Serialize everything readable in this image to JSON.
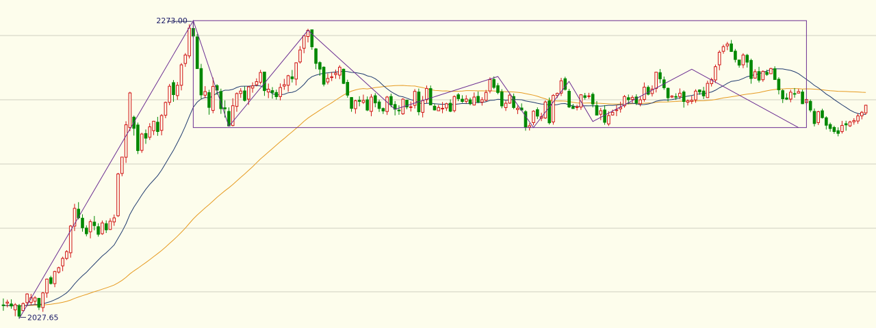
{
  "chart_data": {
    "type": "candlestick",
    "ylim": [
      2020,
      2290
    ],
    "grid": true,
    "colors": {
      "up": "#d01010",
      "down": "#008800",
      "ma_short": "#1f3a6e",
      "ma_long": "#e69a20",
      "annotation": "#6a2c91",
      "grid": "#cfcfc0",
      "background": "#fdfdec"
    },
    "annotations": {
      "high_label": "2273.00",
      "low_label": "2027.65",
      "high_value": 2273.0,
      "low_value": 2027.65,
      "high_index": 48,
      "low_index": 4,
      "range_box": {
        "from_index": 48,
        "to_index": 203,
        "top": 2273.0,
        "bottom": 2185.0
      },
      "wave_points": [
        [
          4,
          2027.65
        ],
        [
          48,
          2273.0
        ],
        [
          57,
          2186.0
        ],
        [
          77,
          2265.0
        ],
        [
          99,
          2200.0
        ],
        [
          125,
          2227.0
        ],
        [
          134,
          2185.0
        ],
        [
          143,
          2223.0
        ],
        [
          149,
          2190.0
        ],
        [
          174,
          2233.0
        ],
        [
          201,
          2185.0
        ]
      ]
    },
    "candles": [
      [
        2039.0,
        2038.4,
        2044.3,
        2034.2
      ],
      [
        2040.4,
        2041.3,
        2043.3,
        2037.0
      ],
      [
        2039.8,
        2038.1,
        2043.6,
        2035.9
      ],
      [
        2034.9,
        2039.1,
        2040.5,
        2029.7
      ],
      [
        2038.5,
        2029.7,
        2039.8,
        2027.6
      ],
      [
        2034.3,
        2040.1,
        2041.1,
        2033.9
      ],
      [
        2040.9,
        2048.0,
        2048.6,
        2037.9
      ],
      [
        2041.0,
        2044.9,
        2048.1,
        2038.8
      ],
      [
        2042.0,
        2044.8,
        2046.3,
        2039.1
      ],
      [
        2044.4,
        2037.1,
        2044.8,
        2034.8
      ],
      [
        2036.8,
        2048.9,
        2049.6,
        2033.3
      ],
      [
        2048.8,
        2060.3,
        2060.6,
        2044.9
      ],
      [
        2061.4,
        2056.6,
        2063.0,
        2055.8
      ],
      [
        2056.5,
        2066.5,
        2067.1,
        2053.6
      ],
      [
        2066.0,
        2069.6,
        2070.5,
        2064.8
      ],
      [
        2071.1,
        2077.3,
        2078.7,
        2066.8
      ],
      [
        2077.3,
        2082.9,
        2084.1,
        2076.0
      ],
      [
        2081.9,
        2103.9,
        2104.8,
        2077.9
      ],
      [
        2103.9,
        2118.5,
        2122.2,
        2099.8
      ],
      [
        2117.8,
        2110.7,
        2123.6,
        2109.4
      ],
      [
        2110.4,
        2102.5,
        2113.6,
        2099.3
      ],
      [
        2102.3,
        2097.6,
        2104.5,
        2095.5
      ],
      [
        2099.2,
        2107.5,
        2109.3,
        2093.8
      ],
      [
        2107.2,
        2104.3,
        2112.2,
        2100.4
      ],
      [
        2103.4,
        2097.1,
        2106.2,
        2095.2
      ],
      [
        2097.6,
        2106.5,
        2108.5,
        2096.7
      ],
      [
        2105.9,
        2100.8,
        2108.6,
        2098.2
      ],
      [
        2101.1,
        2107.9,
        2110.3,
        2100.7
      ],
      [
        2107.3,
        2110.6,
        2113.4,
        2104.1
      ],
      [
        2112.4,
        2146.8,
        2147.7,
        2111.4
      ],
      [
        2147.2,
        2160.7,
        2160.7,
        2144.9
      ],
      [
        2160.6,
        2187.3,
        2190.2,
        2155.9
      ],
      [
        2185.0,
        2213.5,
        2214.4,
        2182.0
      ],
      [
        2193.6,
        2184.4,
        2194.8,
        2178.4
      ],
      [
        2187.1,
        2166.0,
        2189.1,
        2163.2
      ],
      [
        2166.2,
        2179.7,
        2180.7,
        2164.2
      ],
      [
        2180.1,
        2176.3,
        2183.4,
        2171.6
      ],
      [
        2177.0,
        2185.6,
        2188.6,
        2174.8
      ],
      [
        2182.4,
        2190.2,
        2190.5,
        2178.8
      ],
      [
        2189.4,
        2181.7,
        2193.8,
        2178.2
      ],
      [
        2182.7,
        2194.9,
        2196.1,
        2178.6
      ],
      [
        2195.1,
        2205.7,
        2206.4,
        2192.7
      ],
      [
        2205.7,
        2219.0,
        2220.9,
        2203.4
      ],
      [
        2222.0,
        2212.1,
        2224.1,
        2206.2
      ],
      [
        2211.3,
        2219.8,
        2222.5,
        2207.8
      ],
      [
        2219.8,
        2236.6,
        2238.1,
        2215.6
      ],
      [
        2237.7,
        2244.7,
        2246.3,
        2235.0
      ],
      [
        2244.0,
        2266.9,
        2270.0,
        2241.9
      ],
      [
        2266.6,
        2260.3,
        2273.0,
        2258.6
      ],
      [
        2259.6,
        2233.5,
        2262.0,
        2233.4
      ],
      [
        2233.6,
        2211.9,
        2237.4,
        2208.3
      ],
      [
        2211.6,
        2214.6,
        2219.1,
        2209.1
      ],
      [
        2213.8,
        2201.6,
        2216.1,
        2195.6
      ],
      [
        2199.1,
        2218.9,
        2226.1,
        2196.8
      ],
      [
        2219.5,
        2215.8,
        2220.7,
        2211.9
      ],
      [
        2214.7,
        2200.6,
        2217.0,
        2196.3
      ],
      [
        2201.3,
        2200.4,
        2207.4,
        2193.2
      ],
      [
        2198.3,
        2186.3,
        2201.6,
        2186.0
      ],
      [
        2186.7,
        2203.0,
        2209.1,
        2186.0
      ],
      [
        2202.4,
        2213.0,
        2213.9,
        2198.0
      ],
      [
        2213.1,
        2215.1,
        2217.5,
        2209.4
      ],
      [
        2215.2,
        2207.3,
        2218.8,
        2206.5
      ],
      [
        2208.4,
        2218.5,
        2219.2,
        2203.7
      ],
      [
        2217.5,
        2219.3,
        2222.2,
        2213.7
      ],
      [
        2220.2,
        2222.8,
        2225.5,
        2218.9
      ],
      [
        2222.3,
        2230.3,
        2232.5,
        2220.5
      ],
      [
        2230.7,
        2215.4,
        2230.8,
        2211.1
      ],
      [
        2214.3,
        2216.6,
        2221.2,
        2209.2
      ],
      [
        2215.4,
        2213.9,
        2218.3,
        2208.8
      ],
      [
        2213.9,
        2210.4,
        2216.2,
        2208.0
      ],
      [
        2210.5,
        2218.0,
        2221.3,
        2207.4
      ],
      [
        2219.1,
        2220.3,
        2225.1,
        2216.1
      ],
      [
        2219.8,
        2227.7,
        2228.4,
        2214.5
      ],
      [
        2226.8,
        2225.2,
        2232.4,
        2222.1
      ],
      [
        2224.9,
        2238.3,
        2238.7,
        2219.7
      ],
      [
        2239.0,
        2248.9,
        2252.0,
        2237.7
      ],
      [
        2250.2,
        2260.5,
        2260.7,
        2246.2
      ],
      [
        2259.9,
        2265.0,
        2266.3,
        2255.1
      ],
      [
        2265.5,
        2251.5,
        2265.6,
        2249.0
      ],
      [
        2249.8,
        2237.8,
        2250.5,
        2233.1
      ],
      [
        2238.5,
        2233.1,
        2239.6,
        2227.6
      ],
      [
        2234.7,
        2220.7,
        2235.4,
        2218.9
      ],
      [
        2222.5,
        2225.4,
        2229.5,
        2220.5
      ],
      [
        2226.1,
        2226.8,
        2230.7,
        2223.3
      ],
      [
        2228.7,
        2229.8,
        2232.7,
        2225.2
      ],
      [
        2228.2,
        2234.7,
        2236.3,
        2224.9
      ],
      [
        2233.0,
        2221.3,
        2233.6,
        2220.8
      ],
      [
        2222.2,
        2211.6,
        2224.4,
        2209.6
      ],
      [
        2209.8,
        2200.8,
        2210.0,
        2198.0
      ],
      [
        2200.6,
        2207.1,
        2207.9,
        2196.4
      ],
      [
        2207.4,
        2206.5,
        2210.8,
        2202.5
      ],
      [
        2205.7,
        2207.3,
        2212.1,
        2204.4
      ],
      [
        2207.9,
        2199.4,
        2210.6,
        2198.5
      ],
      [
        2198.3,
        2210.1,
        2212.5,
        2194.3
      ],
      [
        2211.2,
        2205.3,
        2213.3,
        2201.7
      ],
      [
        2206.1,
        2200.7,
        2208.0,
        2197.9
      ],
      [
        2200.7,
        2198.7,
        2201.5,
        2196.2
      ],
      [
        2198.2,
        2210.1,
        2211.0,
        2195.4
      ],
      [
        2210.6,
        2203.6,
        2212.9,
        2201.7
      ],
      [
        2204.0,
        2200.1,
        2206.8,
        2195.0
      ],
      [
        2199.4,
        2198.8,
        2203.3,
        2195.5
      ],
      [
        2196.3,
        2208.4,
        2209.2,
        2195.5
      ],
      [
        2207.6,
        2201.9,
        2207.7,
        2200.1
      ],
      [
        2201.7,
        2202.1,
        2206.4,
        2198.2
      ],
      [
        2203.3,
        2214.8,
        2216.7,
        2200.7
      ],
      [
        2214.3,
        2198.0,
        2217.1,
        2195.1
      ],
      [
        2197.5,
        2207.2,
        2211.0,
        2193.4
      ],
      [
        2207.9,
        2217.2,
        2219.6,
        2205.1
      ],
      [
        2217.1,
        2203.6,
        2219.6,
        2203.4
      ],
      [
        2202.6,
        2199.5,
        2204.8,
        2199.0
      ],
      [
        2198.8,
        2201.5,
        2203.6,
        2198.6
      ],
      [
        2200.8,
        2200.9,
        2206.0,
        2196.8
      ],
      [
        2201.1,
        2204.6,
        2205.4,
        2198.7
      ],
      [
        2205.0,
        2198.4,
        2208.2,
        2197.7
      ],
      [
        2198.9,
        2210.5,
        2211.5,
        2197.5
      ],
      [
        2212.0,
        2208.8,
        2213.4,
        2206.7
      ],
      [
        2208.4,
        2206.5,
        2211.6,
        2205.4
      ],
      [
        2206.6,
        2208.5,
        2211.6,
        2204.8
      ],
      [
        2207.8,
        2204.6,
        2209.6,
        2203.3
      ],
      [
        2203.5,
        2210.1,
        2213.9,
        2203.2
      ],
      [
        2210.7,
        2206.2,
        2214.7,
        2205.0
      ],
      [
        2206.0,
        2207.9,
        2210.0,
        2203.1
      ],
      [
        2207.5,
        2213.9,
        2216.0,
        2206.5
      ],
      [
        2215.1,
        2224.5,
        2226.3,
        2213.2
      ],
      [
        2224.6,
        2218.1,
        2227.1,
        2216.7
      ],
      [
        2219.5,
        2213.8,
        2221.6,
        2212.4
      ],
      [
        2214.4,
        2202.8,
        2216.6,
        2200.9
      ],
      [
        2201.4,
        2205.0,
        2207.1,
        2198.7
      ],
      [
        2205.1,
        2211.7,
        2213.7,
        2204.5
      ],
      [
        2210.6,
        2201.5,
        2213.0,
        2200.1
      ],
      [
        2199.8,
        2200.9,
        2203.2,
        2196.1
      ],
      [
        2201.1,
        2199.4,
        2204.9,
        2199.0
      ],
      [
        2198.1,
        2185.4,
        2199.3,
        2182.4
      ],
      [
        2185.2,
        2186.5,
        2188.7,
        2182.6
      ],
      [
        2189.1,
        2198.5,
        2199.2,
        2186.9
      ],
      [
        2199.7,
        2194.4,
        2201.6,
        2192.0
      ],
      [
        2192.7,
        2194.0,
        2197.2,
        2190.3
      ],
      [
        2192.9,
        2206.1,
        2207.3,
        2192.1
      ],
      [
        2206.9,
        2188.9,
        2209.7,
        2187.5
      ],
      [
        2189.6,
        2211.5,
        2212.5,
        2187.4
      ],
      [
        2211.4,
        2213.1,
        2213.8,
        2209.3
      ],
      [
        2213.3,
        2223.5,
        2225.9,
        2211.0
      ],
      [
        2225.2,
        2216.4,
        2226.8,
        2215.5
      ],
      [
        2214.9,
        2201.9,
        2216.8,
        2201.1
      ],
      [
        2202.3,
        2200.6,
        2204.5,
        2200.6
      ],
      [
        2201.7,
        2202.0,
        2203.8,
        2199.1
      ],
      [
        2201.9,
        2212.0,
        2212.5,
        2199.6
      ],
      [
        2211.2,
        2209.8,
        2213.5,
        2208.0
      ],
      [
        2210.8,
        2211.1,
        2213.6,
        2208.7
      ],
      [
        2212.4,
        2204.4,
        2213.9,
        2201.6
      ],
      [
        2203.1,
        2195.2,
        2206.8,
        2195.1
      ],
      [
        2196.0,
        2198.9,
        2201.2,
        2191.1
      ],
      [
        2199.5,
        2189.3,
        2203.4,
        2187.3
      ],
      [
        2188.0,
        2194.9,
        2198.4,
        2186.3
      ],
      [
        2195.3,
        2197.5,
        2199.8,
        2194.9
      ],
      [
        2199.0,
        2199.6,
        2203.4,
        2194.4
      ],
      [
        2200.4,
        2201.6,
        2206.3,
        2197.3
      ],
      [
        2202.9,
        2210.5,
        2211.8,
        2201.4
      ],
      [
        2209.6,
        2207.9,
        2212.2,
        2204.2
      ],
      [
        2208.2,
        2209.8,
        2211.5,
        2205.4
      ],
      [
        2210.2,
        2205.3,
        2212.4,
        2203.5
      ],
      [
        2204.6,
        2207.8,
        2210.6,
        2202.5
      ],
      [
        2208.1,
        2218.3,
        2222.1,
        2206.3
      ],
      [
        2218.1,
        2212.4,
        2219.7,
        2211.5
      ],
      [
        2213.0,
        2216.7,
        2219.7,
        2210.6
      ],
      [
        2217.2,
        2230.6,
        2230.9,
        2213.9
      ],
      [
        2230.2,
        2225.1,
        2233.2,
        2221.5
      ],
      [
        2224.3,
        2217.8,
        2227.0,
        2216.1
      ],
      [
        2217.3,
        2209.5,
        2218.0,
        2206.5
      ],
      [
        2210.1,
        2210.9,
        2211.7,
        2209.2
      ],
      [
        2210.6,
        2210.4,
        2213.2,
        2207.7
      ],
      [
        2210.5,
        2213.3,
        2217.2,
        2208.5
      ],
      [
        2214.3,
        2206.5,
        2215.6,
        2201.4
      ],
      [
        2205.9,
        2207.0,
        2208.2,
        2203.2
      ],
      [
        2206.5,
        2207.4,
        2211.1,
        2204.4
      ],
      [
        2207.8,
        2215.0,
        2216.5,
        2205.4
      ],
      [
        2216.0,
        2214.3,
        2216.4,
        2212.0
      ],
      [
        2215.1,
        2211.1,
        2218.5,
        2208.5
      ],
      [
        2209.7,
        2221.4,
        2223.6,
        2209.4
      ],
      [
        2221.1,
        2224.5,
        2226.0,
        2218.8
      ],
      [
        2224.2,
        2235.1,
        2236.8,
        2221.7
      ],
      [
        2236.6,
        2247.0,
        2248.6,
        2232.2
      ],
      [
        2247.8,
        2251.6,
        2253.2,
        2245.8
      ],
      [
        2252.3,
        2253.8,
        2255.5,
        2248.7
      ],
      [
        2253.9,
        2247.6,
        2257.1,
        2247.4
      ],
      [
        2247.9,
        2241.0,
        2249.7,
        2238.6
      ],
      [
        2240.6,
        2236.4,
        2240.8,
        2234.3
      ],
      [
        2236.6,
        2244.7,
        2246.2,
        2233.9
      ],
      [
        2244.5,
        2238.8,
        2245.7,
        2234.4
      ],
      [
        2240.3,
        2225.4,
        2241.7,
        2221.1
      ],
      [
        2225.7,
        2231.0,
        2233.0,
        2225.3
      ],
      [
        2231.1,
        2224.0,
        2235.0,
        2222.1
      ],
      [
        2224.4,
        2231.3,
        2232.1,
        2222.7
      ],
      [
        2230.5,
        2228.7,
        2232.7,
        2227.5
      ],
      [
        2229.3,
        2233.6,
        2234.2,
        2229.0
      ],
      [
        2233.4,
        2224.5,
        2235.4,
        2224.4
      ],
      [
        2224.8,
        2216.1,
        2226.4,
        2212.3
      ],
      [
        2215.4,
        2208.7,
        2216.6,
        2205.2
      ],
      [
        2209.4,
        2208.4,
        2213.2,
        2207.7
      ],
      [
        2208.4,
        2214.1,
        2216.2,
        2205.8
      ],
      [
        2213.0,
        2212.5,
        2217.5,
        2209.6
      ],
      [
        2213.3,
        2214.6,
        2216.8,
        2213.2
      ],
      [
        2214.3,
        2204.6,
        2216.3,
        2204.3
      ],
      [
        2205.5,
        2208.1,
        2209.3,
        2203.4
      ],
      [
        2206.6,
        2199.4,
        2208.1,
        2197.6
      ],
      [
        2198.3,
        2188.3,
        2200.7,
        2185.9
      ],
      [
        2189.1,
        2198.1,
        2198.8,
        2187.1
      ],
      [
        2198.8,
        2193.1,
        2200.5,
        2192.4
      ],
      [
        2193.1,
        2186.9,
        2194.3,
        2183.4
      ],
      [
        2187.5,
        2184.2,
        2189.1,
        2181.6
      ],
      [
        2185.1,
        2181.7,
        2186.5,
        2179.9
      ],
      [
        2182.4,
        2180.2,
        2185.2,
        2177.8
      ],
      [
        2181.7,
        2186.8,
        2190.5,
        2180.1
      ],
      [
        2188.2,
        2187.2,
        2190.6,
        2182.4
      ],
      [
        2186.4,
        2189.6,
        2190.6,
        2185.4
      ],
      [
        2189.8,
        2190.8,
        2192.7,
        2187.4
      ],
      [
        2190.4,
        2194.6,
        2196.6,
        2188.1
      ],
      [
        2194.6,
        2197.6,
        2198.6,
        2191.8
      ],
      [
        2197.1,
        2203.4,
        2203.8,
        2195.6
      ]
    ]
  }
}
